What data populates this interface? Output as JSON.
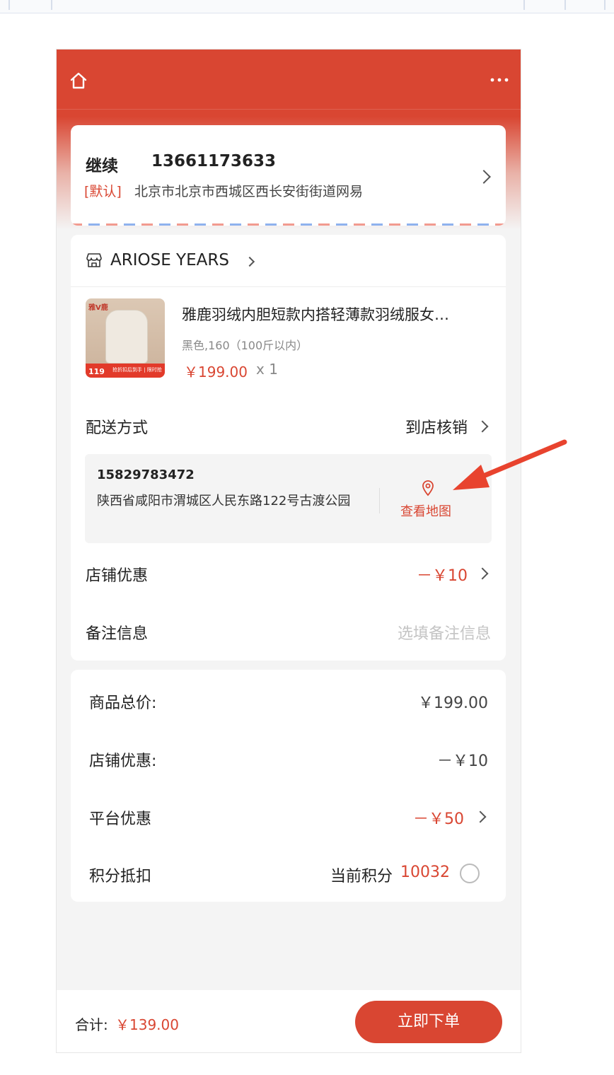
{
  "address": {
    "name": "继续",
    "phone": "13661173633",
    "tag": "[默认]",
    "text": "北京市北京市西城区西长安街街道网易"
  },
  "store": {
    "name": "ARIOSE YEARS",
    "product": {
      "title": "雅鹿羽绒内胆短款内搭轻薄款羽绒服女…",
      "spec": "黑色,160（100斤以内）",
      "price": "￥199.00",
      "qty": "x 1",
      "image_badge_brand": "雅V鹿",
      "image_badge_price": "119",
      "image_badge_text": "抢折扣后到手 | 限时抢"
    },
    "delivery": {
      "label": "配送方式",
      "value": "到店核销"
    },
    "pickup": {
      "phone": "15829783472",
      "address": "陕西省咸阳市渭城区人民东路122号古渡公园",
      "map_label": "查看地图"
    },
    "shop_discount": {
      "label": "店铺优惠",
      "value": "－￥10"
    },
    "remark": {
      "label": "备注信息",
      "placeholder": "选填备注信息"
    }
  },
  "summary": {
    "goods_total_label": "商品总价:",
    "goods_total_value": "￥199.00",
    "shop_discount_label": "店铺优惠:",
    "shop_discount_value": "－￥10",
    "platform_discount_label": "平台优惠",
    "platform_discount_value": "－￥50",
    "points_label": "积分抵扣",
    "points_prefix": "当前积分",
    "points_value": "10032"
  },
  "footer": {
    "total_label": "合计:",
    "total_value": "￥139.00",
    "order_button": "立即下单"
  },
  "colors": {
    "brand": "#d94632",
    "background": "#f4f4f4"
  },
  "icons": [
    "home-icon",
    "more-icon",
    "store-icon",
    "chevron-right-icon",
    "location-pin-icon",
    "radio-icon",
    "arrow-annotation"
  ]
}
